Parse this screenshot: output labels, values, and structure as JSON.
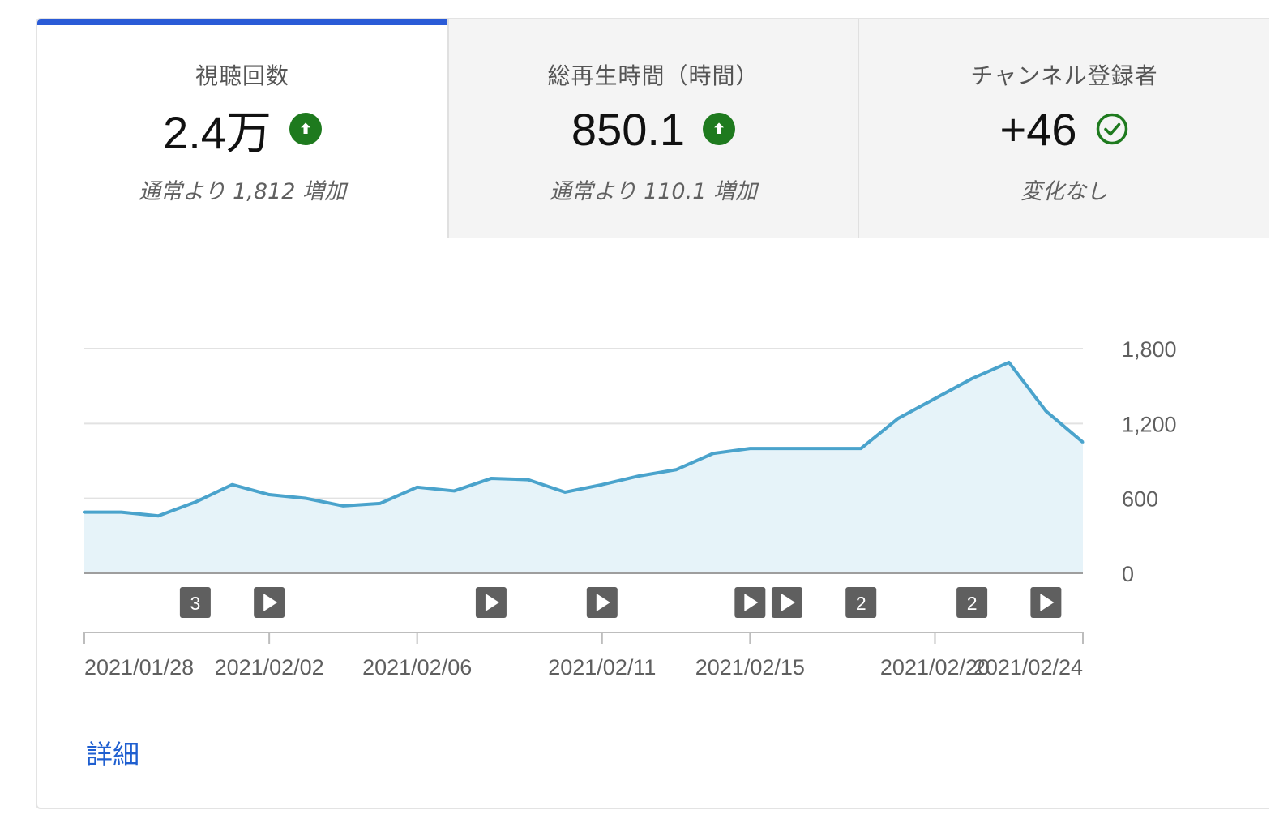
{
  "tabs": [
    {
      "title": "視聴回数",
      "value": "2.4万",
      "status_icon": "arrow-up-circle-icon",
      "sub": "通常より 1,812 増加",
      "active": true
    },
    {
      "title": "総再生時間（時間）",
      "value": "850.1",
      "status_icon": "arrow-up-circle-icon",
      "sub": "通常より 110.1 増加",
      "active": false
    },
    {
      "title": "チャンネル登録者",
      "value": "+46",
      "status_icon": "check-circle-icon",
      "sub": "変化なし",
      "active": false
    }
  ],
  "colors": {
    "accent": "#2a5bd7",
    "up": "#1e7a1e",
    "line": "#4aa3cc",
    "fill": "#e6f3f9",
    "link": "#1f5fd0"
  },
  "chart_data": {
    "type": "area",
    "x": [
      "2021/01/28",
      "2021/01/29",
      "2021/01/30",
      "2021/01/31",
      "2021/02/01",
      "2021/02/02",
      "2021/02/03",
      "2021/02/04",
      "2021/02/05",
      "2021/02/06",
      "2021/02/07",
      "2021/02/08",
      "2021/02/09",
      "2021/02/10",
      "2021/02/11",
      "2021/02/12",
      "2021/02/13",
      "2021/02/14",
      "2021/02/15",
      "2021/02/16",
      "2021/02/17",
      "2021/02/18",
      "2021/02/19",
      "2021/02/20",
      "2021/02/21",
      "2021/02/22",
      "2021/02/23",
      "2021/02/24"
    ],
    "values": [
      490,
      490,
      460,
      570,
      710,
      630,
      600,
      540,
      560,
      690,
      660,
      760,
      750,
      650,
      710,
      780,
      830,
      960,
      1000,
      1000,
      1000,
      1000,
      1240,
      1400,
      1560,
      1690,
      1300,
      1050
    ],
    "ylim": [
      0,
      1800
    ],
    "yticks": [
      0,
      600,
      1200,
      1800
    ],
    "ytick_labels": [
      "0",
      "600",
      "1,200",
      "1,800"
    ],
    "xtick_labels": [
      {
        "date": "2021/01/28",
        "label": "2021/01/28"
      },
      {
        "date": "2021/02/02",
        "label": "2021/02/02"
      },
      {
        "date": "2021/02/06",
        "label": "2021/02/06"
      },
      {
        "date": "2021/02/11",
        "label": "2021/02/11"
      },
      {
        "date": "2021/02/15",
        "label": "2021/02/15"
      },
      {
        "date": "2021/02/20",
        "label": "2021/02/20"
      },
      {
        "date": "2021/02/24",
        "label": "2021/02/24"
      }
    ],
    "markers": [
      {
        "date": "2021/01/31",
        "kind": "count",
        "label": "3"
      },
      {
        "date": "2021/02/02",
        "kind": "video"
      },
      {
        "date": "2021/02/08",
        "kind": "video"
      },
      {
        "date": "2021/02/11",
        "kind": "video"
      },
      {
        "date": "2021/02/15",
        "kind": "video"
      },
      {
        "date": "2021/02/16",
        "kind": "video"
      },
      {
        "date": "2021/02/18",
        "kind": "count",
        "label": "2"
      },
      {
        "date": "2021/02/21",
        "kind": "count",
        "label": "2"
      },
      {
        "date": "2021/02/23",
        "kind": "video"
      }
    ],
    "grid": true,
    "legend": "none"
  },
  "footer": {
    "details_label": "詳細"
  }
}
